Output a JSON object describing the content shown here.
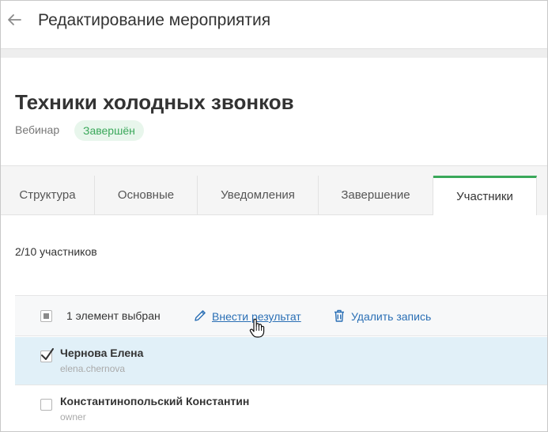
{
  "header": {
    "title": "Редактирование мероприятия"
  },
  "event": {
    "title": "Техники холодных звонков",
    "type": "Вебинар",
    "status": "Завершён",
    "status_color": "#3aa85a"
  },
  "tabs": [
    {
      "label": "Структура"
    },
    {
      "label": "Основные"
    },
    {
      "label": "Уведомления"
    },
    {
      "label": "Завершение"
    },
    {
      "label": "Участники"
    }
  ],
  "participants": {
    "count_text": "2/10 участников",
    "toolbar": {
      "selected_text": "1 элемент выбран",
      "enter_result_label": "Внести результат",
      "delete_label": "Удалить запись"
    },
    "rows": [
      {
        "name": "Чернова Елена",
        "sub": "elena.chernova",
        "checked": true
      },
      {
        "name": "Константинопольский Константин",
        "sub": "owner",
        "checked": false
      }
    ]
  },
  "colors": {
    "accent": "#3aa85a",
    "link": "#2a6fb5",
    "selected_row": "#e1f0f8"
  }
}
